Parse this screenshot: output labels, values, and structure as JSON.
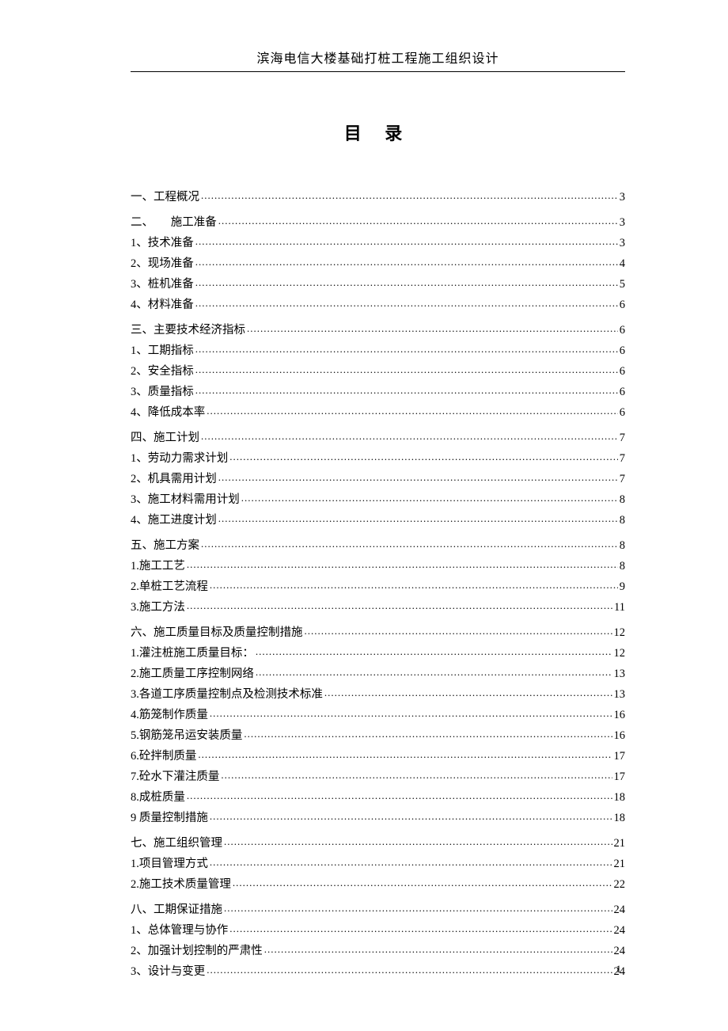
{
  "header": "滨海电信大楼基础打桩工程施工组织设计",
  "title": "目  录",
  "page_number": "1",
  "toc": [
    {
      "type": "section",
      "entries": [
        {
          "label": "一、工程概况",
          "page": "3"
        }
      ]
    },
    {
      "type": "section",
      "entries": [
        {
          "label": "二、　　施工准备",
          "page": "3"
        },
        {
          "label": "1、技术准备",
          "page": "3",
          "sub": true
        },
        {
          "label": "2、现场准备",
          "page": "4",
          "sub": true
        },
        {
          "label": "3、桩机准备",
          "page": "5",
          "sub": true
        },
        {
          "label": "4、材料准备",
          "page": "6",
          "sub": true
        }
      ]
    },
    {
      "type": "section",
      "entries": [
        {
          "label": "三、主要技术经济指标",
          "page": "6"
        },
        {
          "label": "1、工期指标",
          "page": "6",
          "sub": true
        },
        {
          "label": "2、安全指标",
          "page": "6",
          "sub": true
        },
        {
          "label": "3、质量指标",
          "page": "6",
          "sub": true
        },
        {
          "label": "4、降低成本率",
          "page": "6",
          "sub": true
        }
      ]
    },
    {
      "type": "section",
      "entries": [
        {
          "label": "四、施工计划",
          "page": "7"
        },
        {
          "label": "1、劳动力需求计划",
          "page": "7",
          "sub": true
        },
        {
          "label": "2、机具需用计划",
          "page": "7",
          "sub": true
        },
        {
          "label": "3、施工材料需用计划",
          "page": "8",
          "sub": true
        },
        {
          "label": "4、施工进度计划",
          "page": "8",
          "sub": true
        }
      ]
    },
    {
      "type": "section",
      "entries": [
        {
          "label": "五、施工方案",
          "page": "8"
        },
        {
          "label": "1.施工工艺",
          "page": "8",
          "sub": true
        },
        {
          "label": "2.单桩工艺流程",
          "page": "9",
          "sub": true
        },
        {
          "label": "3.施工方法",
          "page": "11",
          "sub": true
        }
      ]
    },
    {
      "type": "section",
      "entries": [
        {
          "label": "六、施工质量目标及质量控制措施",
          "page": "12"
        },
        {
          "label": "1.灌注桩施工质量目标：",
          "page": "12",
          "sub": true
        },
        {
          "label": "2.施工质量工序控制网络",
          "page": "13",
          "sub": true
        },
        {
          "label": "3.各道工序质量控制点及检测技术标准",
          "page": "13",
          "sub": true
        },
        {
          "label": "4.筋笼制作质量",
          "page": "16",
          "sub": true
        },
        {
          "label": "5.钢筋笼吊运安装质量",
          "page": "16",
          "sub": true
        },
        {
          "label": "6.砼拌制质量",
          "page": "17",
          "sub": true
        },
        {
          "label": "7.砼水下灌注质量",
          "page": "17",
          "sub": true
        },
        {
          "label": "8.成桩质量",
          "page": "18",
          "sub": true
        },
        {
          "label": "9 质量控制措施",
          "page": "18",
          "sub": true
        }
      ]
    },
    {
      "type": "section",
      "entries": [
        {
          "label": "七、施工组织管理",
          "page": "21"
        },
        {
          "label": "1.项目管理方式",
          "page": "21",
          "sub": true
        },
        {
          "label": "2.施工技术质量管理",
          "page": "22",
          "sub": true
        }
      ]
    },
    {
      "type": "section",
      "entries": [
        {
          "label": "八、工期保证措施",
          "page": "24"
        },
        {
          "label": "1、总体管理与协作",
          "page": "24",
          "sub": true
        },
        {
          "label": "2、加强计划控制的严肃性",
          "page": "24",
          "sub": true
        },
        {
          "label": "3、设计与变更",
          "page": "24",
          "sub": true
        }
      ]
    }
  ]
}
